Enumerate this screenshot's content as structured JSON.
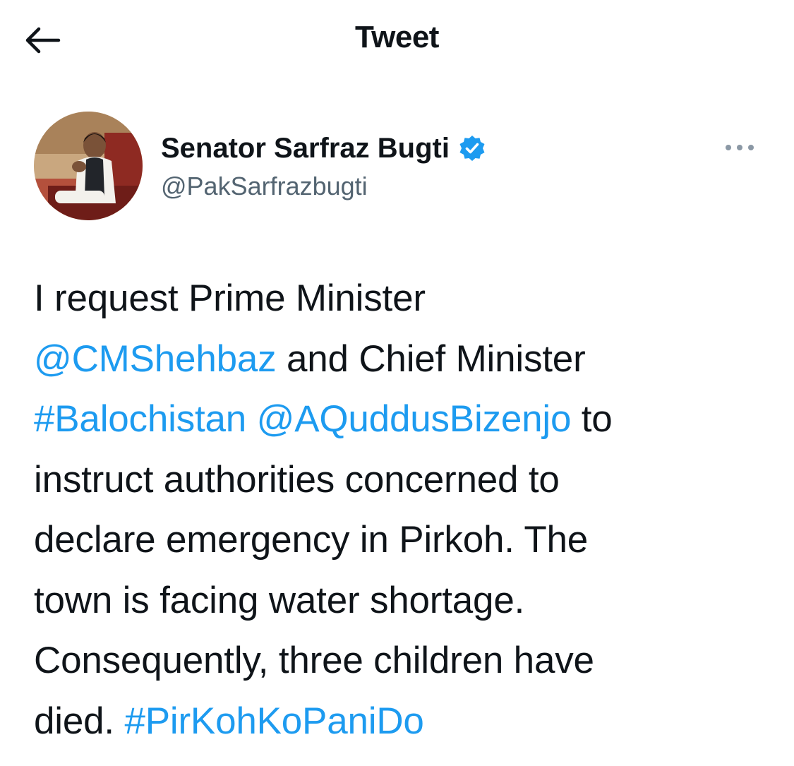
{
  "header": {
    "title": "Tweet",
    "back_icon": "arrow-left-icon"
  },
  "author": {
    "display_name": "Senator Sarfraz Bugti",
    "handle": "@PakSarfrazbugti",
    "verified": true,
    "verified_icon": "verified-badge-icon",
    "avatar": "avatar-photo",
    "more_icon": "more-options-icon"
  },
  "tweet": {
    "segments": [
      {
        "type": "text",
        "text": "I request Prime Minister"
      },
      {
        "type": "mention",
        "text": "@CMShehbaz"
      },
      {
        "type": "text",
        "text": " and Chief Minister"
      },
      {
        "type": "hashtag",
        "text": "#Balochistan"
      },
      {
        "type": "text",
        "text": " "
      },
      {
        "type": "mention",
        "text": "@AQuddusBizenjo"
      },
      {
        "type": "text",
        "text": " to"
      },
      {
        "type": "text",
        "text": "instruct authorities concerned to"
      },
      {
        "type": "text",
        "text": "declare emergency in Pirkoh. The"
      },
      {
        "type": "text",
        "text": "town is facing water shortage."
      },
      {
        "type": "text",
        "text": "Consequently, three children have"
      },
      {
        "type": "text",
        "text": "died. "
      },
      {
        "type": "hashtag",
        "text": "#PirKohKoPaniDo"
      }
    ]
  },
  "colors": {
    "link": "#1d9bf0",
    "text": "#0f1419",
    "secondary": "#536471",
    "verified": "#1d9bf0"
  }
}
